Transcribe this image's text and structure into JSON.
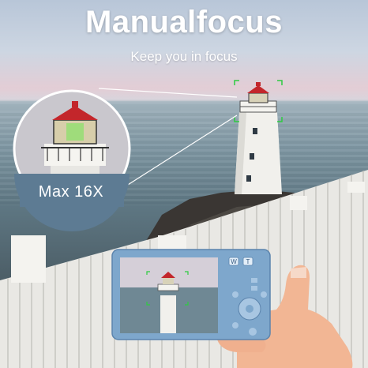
{
  "headline": {
    "title": "Manualfocus",
    "subtitle": "Keep you in focus"
  },
  "zoom_callout": {
    "label": "Max 16X"
  },
  "camera": {
    "color": "#7ea7cc",
    "button_labels": [
      "W",
      "T"
    ]
  },
  "icons": [
    "lighthouse-icon",
    "focus-bracket-icon"
  ]
}
